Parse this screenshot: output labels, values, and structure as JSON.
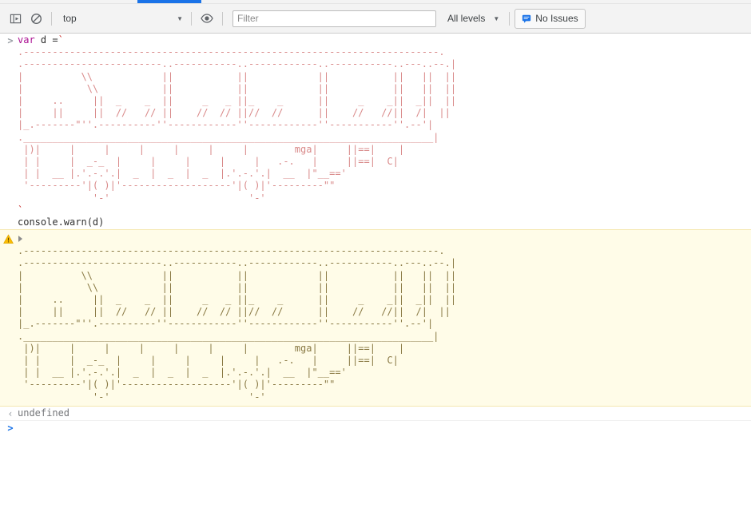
{
  "toolbar": {
    "sidebar_toggle_icon": "console-sidebar-icon",
    "clear_console_icon": "clear-console-icon",
    "context_selector": {
      "value": "top",
      "caret": "▼"
    },
    "eye_icon": "live-expression-eye-icon",
    "filter": {
      "value": "",
      "placeholder": "Filter"
    },
    "levels": {
      "label": "All levels",
      "caret": "▼"
    },
    "issues": {
      "icon": "issues-speech-bubble-icon",
      "label": "No Issues"
    },
    "accent_color": "#1a73e8"
  },
  "console": {
    "input_prompt_glyph": ">",
    "result_prompt_glyph": "‹",
    "prompt_glyph": ">",
    "warning_icon": "warning-triangle-icon",
    "disclosure_icon": "disclosure-triangle-right-icon",
    "command": {
      "keyword": "var",
      "identifier": " d ",
      "operator": "=",
      "template_open": "`",
      "template_close": "`",
      "call": "console.warn(d)"
    },
    "result": {
      "value": "undefined"
    },
    "ascii_art": ".------------------------------------------------------------------------.\n.------------------------..-----------..------------..-----------..---..--.|\n|          \\\\            ||           ||            ||           ||   ||  ||\n|           \\\\           ||           ||            ||           ||   ||  ||\n|     ..     ||  _    _  ||     _   _ ||_    _      ||     _    _||  _||  ||\n|     ||     ||  //   // ||    //  // ||//  //      ||    //   //||  /|  ||\n|_.-------\"''.----------''------------''------------''-----------''.--'|\n._______________________________________________________________________|\n |)|     |     |     |     |     |     |        mga|     ||==|    |\n | |     |  _-_  |     |     |     |     |   .-.   |     ||==|  C|\n | |  __ |.'.-.'.|  _  |  _  |  _  |.'.-.'.|  __  |\"__==' \n '---------'|( )|'-------------------'|( )|'---------\"\"\n             '-'                        '-'",
    "colors": {
      "art_red": "#d98a8a",
      "art_warn": "#8a7a45",
      "warn_bg": "#fffce8",
      "warn_border": "#f5e8b0"
    }
  }
}
